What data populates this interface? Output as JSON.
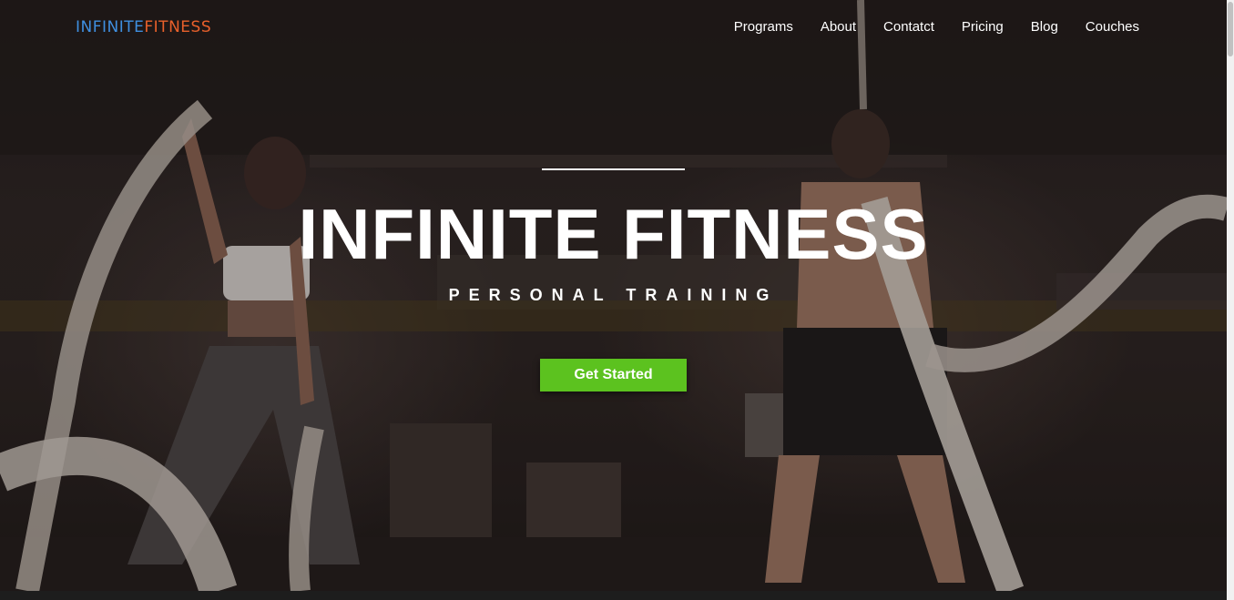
{
  "brand": {
    "part1": "INFINITE",
    "part2": "FITNESS",
    "color1": "#3f8fe0",
    "color2": "#e8602b"
  },
  "nav": [
    {
      "label": "Programs"
    },
    {
      "label": "About"
    },
    {
      "label": "Contatct"
    },
    {
      "label": "Pricing"
    },
    {
      "label": "Blog"
    },
    {
      "label": "Couches"
    }
  ],
  "hero": {
    "title": "INFINITE FITNESS",
    "subtitle": "PERSONAL TRAINING",
    "cta_label": "Get Started",
    "cta_color": "#5cc21f"
  }
}
